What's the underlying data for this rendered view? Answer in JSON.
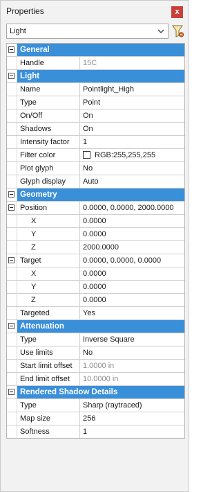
{
  "panel": {
    "title": "Properties",
    "close_label": "x"
  },
  "selector": {
    "value": "Light"
  },
  "colors": {
    "category_header": "#3a8fd9",
    "close_button": "#c8403a"
  },
  "grid": {
    "rows": [
      {
        "type": "category",
        "label": "General",
        "expander": true
      },
      {
        "type": "prop",
        "name": "Handle",
        "value": "15C",
        "readonly": true
      },
      {
        "type": "category",
        "label": "Light",
        "expander": true
      },
      {
        "type": "prop",
        "name": "Name",
        "value": "Pointlight_High"
      },
      {
        "type": "prop",
        "name": "Type",
        "value": "Point"
      },
      {
        "type": "prop",
        "name": "On/Off",
        "value": "On"
      },
      {
        "type": "prop",
        "name": "Shadows",
        "value": "On"
      },
      {
        "type": "prop",
        "name": "Intensity factor",
        "value": "1"
      },
      {
        "type": "prop",
        "name": "Filter color",
        "value": "RGB:255,255,255",
        "swatch": "#ffffff"
      },
      {
        "type": "prop",
        "name": "Plot glyph",
        "value": "No"
      },
      {
        "type": "prop",
        "name": "Glyph display",
        "value": "Auto"
      },
      {
        "type": "category",
        "label": "Geometry",
        "expander": true
      },
      {
        "type": "prop",
        "name": "Position",
        "value": "0.0000, 0.0000, 2000.0000",
        "expander": true
      },
      {
        "type": "prop",
        "name": "X",
        "value": "0.0000",
        "indent": true
      },
      {
        "type": "prop",
        "name": "Y",
        "value": "0.0000",
        "indent": true
      },
      {
        "type": "prop",
        "name": "Z",
        "value": "2000.0000",
        "indent": true
      },
      {
        "type": "prop",
        "name": "Target",
        "value": "0.0000, 0.0000, 0.0000",
        "expander": true
      },
      {
        "type": "prop",
        "name": "X",
        "value": "0.0000",
        "indent": true
      },
      {
        "type": "prop",
        "name": "Y",
        "value": "0.0000",
        "indent": true
      },
      {
        "type": "prop",
        "name": "Z",
        "value": "0.0000",
        "indent": true
      },
      {
        "type": "prop",
        "name": "Targeted",
        "value": "Yes"
      },
      {
        "type": "category",
        "label": "Attenuation",
        "expander": true
      },
      {
        "type": "prop",
        "name": "Type",
        "value": "Inverse Square"
      },
      {
        "type": "prop",
        "name": "Use limits",
        "value": "No"
      },
      {
        "type": "prop",
        "name": "Start limit offset",
        "value": "1.0000 in",
        "readonly": true
      },
      {
        "type": "prop",
        "name": "End limit offset",
        "value": "10.0000 in",
        "readonly": true
      },
      {
        "type": "category",
        "label": "Rendered Shadow Details",
        "expander": true
      },
      {
        "type": "prop",
        "name": "Type",
        "value": "Sharp (raytraced)"
      },
      {
        "type": "prop",
        "name": "Map size",
        "value": "256"
      },
      {
        "type": "prop",
        "name": "Softness",
        "value": "1"
      }
    ]
  }
}
